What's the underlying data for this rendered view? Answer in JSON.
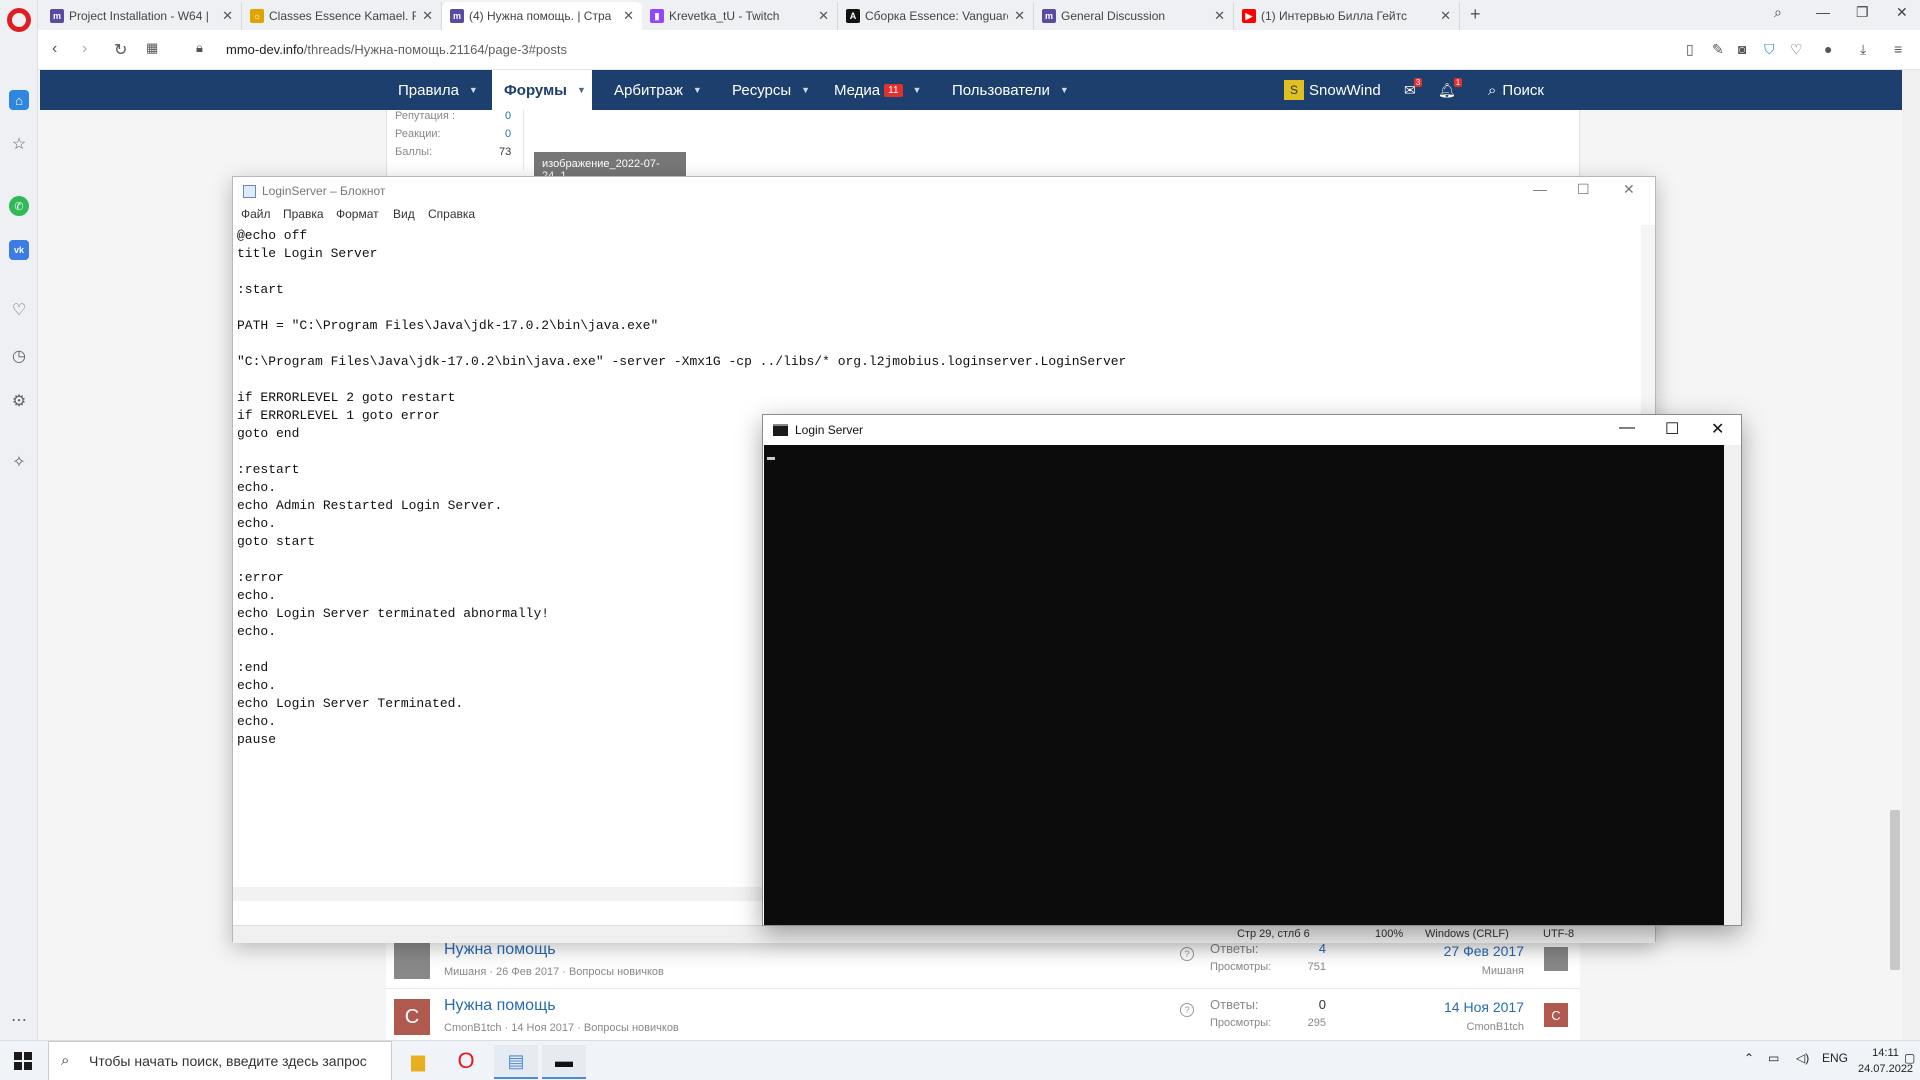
{
  "browser": {
    "tabs": [
      {
        "label": "Project Installation - W64 |",
        "favicon": "mmo-dev-icon",
        "color": "#5b4aa3"
      },
      {
        "label": "Classes Essence Kamael. Fe",
        "favicon": "classes-icon",
        "color": "#e0a400"
      },
      {
        "label": "(4) Нужна помощь. | Стра",
        "favicon": "mmo-dev-icon",
        "color": "#5b4aa3",
        "active": true
      },
      {
        "label": "Krevetka_tU - Twitch",
        "favicon": "twitch-icon",
        "color": "#9146ff"
      },
      {
        "label": "Сборка Essence: Vanguard",
        "favicon": "a-icon",
        "color": "#111111"
      },
      {
        "label": "General Discussion",
        "favicon": "mmo-dev-icon",
        "color": "#5b4aa3"
      },
      {
        "label": "(1) Интервью Билла Гейтс",
        "favicon": "youtube-icon",
        "color": "#ff0000"
      }
    ],
    "url_host": "mmo-dev.info",
    "url_path": "/threads/Нужна-помощь.21164/page-3#posts"
  },
  "forum": {
    "nav": [
      {
        "label": "Правила"
      },
      {
        "label": "Форумы",
        "active": true
      },
      {
        "label": "Арбитраж"
      },
      {
        "label": "Ресурсы"
      },
      {
        "label": "Медиа",
        "badge": "11"
      },
      {
        "label": "Пользователи"
      }
    ],
    "user": {
      "name": "SnowWind",
      "avatar_letter": "S",
      "messages_badge": "3",
      "alerts_badge": "1"
    },
    "search_label": "Поиск",
    "stats": [
      {
        "label": "Репутация :",
        "value": "0"
      },
      {
        "label": "Реакции:",
        "value": "0"
      },
      {
        "label": "Баллы:",
        "value": "73"
      }
    ],
    "thumb_label": "изображение_2022-07-24_1...",
    "threads": [
      {
        "title": "Нужна помощь",
        "meta": "Мишаня · 26 Фев 2017 · Вопросы новичков",
        "replies_label": "Ответы:",
        "replies": "4",
        "views_label": "Просмотры:",
        "views": "751",
        "last_date": "27 Фев 2017",
        "last_user": "Мишаня",
        "avatar": ""
      },
      {
        "title": "Нужна помощь",
        "meta": "CmonB1tch · 14 Ноя 2017 · Вопросы новичков",
        "replies_label": "Ответы:",
        "replies": "0",
        "views_label": "Просмотры:",
        "views": "295",
        "last_date": "14 Ноя 2017",
        "last_user": "CmonB1tch",
        "avatar": "C"
      }
    ]
  },
  "notepad": {
    "title": "LoginServer – Блокнот",
    "menu": [
      "Файл",
      "Правка",
      "Формат",
      "Вид",
      "Справка"
    ],
    "content": "@echo off\ntitle Login Server\n\n:start\n\nPATH = \"C:\\Program Files\\Java\\jdk-17.0.2\\bin\\java.exe\"\n\n\"C:\\Program Files\\Java\\jdk-17.0.2\\bin\\java.exe\" -server -Xmx1G -cp ../libs/* org.l2jmobius.loginserver.LoginServer\n\nif ERRORLEVEL 2 goto restart\nif ERRORLEVEL 1 goto error\ngoto end\n\n:restart\necho.\necho Admin Restarted Login Server.\necho.\ngoto start\n\n:error\necho.\necho Login Server terminated abnormally!\necho.\n\n:end\necho.\necho Login Server Terminated.\necho.\npause",
    "status": {
      "position": "Стр 29, стлб 6",
      "zoom": "100%",
      "eol": "Windows (CRLF)",
      "encoding": "UTF-8"
    }
  },
  "console": {
    "title": "Login Server"
  },
  "taskbar": {
    "search_placeholder": "Чтобы начать поиск, введите здесь запрос",
    "language": "ENG",
    "time": "14:11",
    "date": "24.07.2022"
  },
  "colors": {
    "forum_nav": "#1d3f6e",
    "link": "#2a6cb0",
    "badge": "#e03030",
    "opera_red": "#e01e22"
  }
}
